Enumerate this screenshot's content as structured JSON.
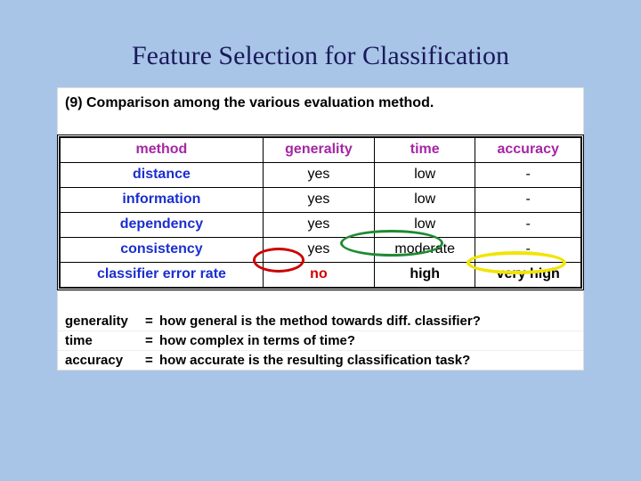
{
  "title": "Feature Selection for Classification",
  "caption": "(9) Comparison among the various evaluation method.",
  "headers": {
    "c0": "method",
    "c1": "generality",
    "c2": "time",
    "c3": "accuracy"
  },
  "rows": [
    {
      "method": "distance",
      "generality": "yes",
      "time": "low",
      "accuracy": "-"
    },
    {
      "method": "information",
      "generality": "yes",
      "time": "low",
      "accuracy": "-"
    },
    {
      "method": "dependency",
      "generality": "yes",
      "time": "low",
      "accuracy": "-"
    },
    {
      "method": "consistency",
      "generality": "yes",
      "time": "moderate",
      "accuracy": "-"
    },
    {
      "method": "classifier error rate",
      "generality": "no",
      "time": "high",
      "accuracy": "very high"
    }
  ],
  "defs": {
    "d0": {
      "term": "generality",
      "eq": "=",
      "val": "how general is the method towards diff. classifier?"
    },
    "d1": {
      "term": "time",
      "eq": "=",
      "val": "how complex in terms of time?"
    },
    "d2": {
      "term": "accuracy",
      "eq": "=",
      "val": "how accurate is the resulting classification task?"
    }
  },
  "chart_data": {
    "type": "table",
    "title": "Comparison among the various evaluation method",
    "columns": [
      "method",
      "generality",
      "time",
      "accuracy"
    ],
    "rows": [
      [
        "distance",
        "yes",
        "low",
        "-"
      ],
      [
        "information",
        "yes",
        "low",
        "-"
      ],
      [
        "dependency",
        "yes",
        "low",
        "-"
      ],
      [
        "consistency",
        "yes",
        "moderate",
        "-"
      ],
      [
        "classifier error rate",
        "no",
        "high",
        "very high"
      ]
    ],
    "highlights": [
      {
        "row": 4,
        "col": "generality",
        "color": "red"
      },
      {
        "row": 3,
        "col": "time",
        "color": "green"
      },
      {
        "row": 4,
        "col": "time",
        "color": "green"
      },
      {
        "row": 4,
        "col": "accuracy",
        "color": "yellow"
      }
    ]
  }
}
